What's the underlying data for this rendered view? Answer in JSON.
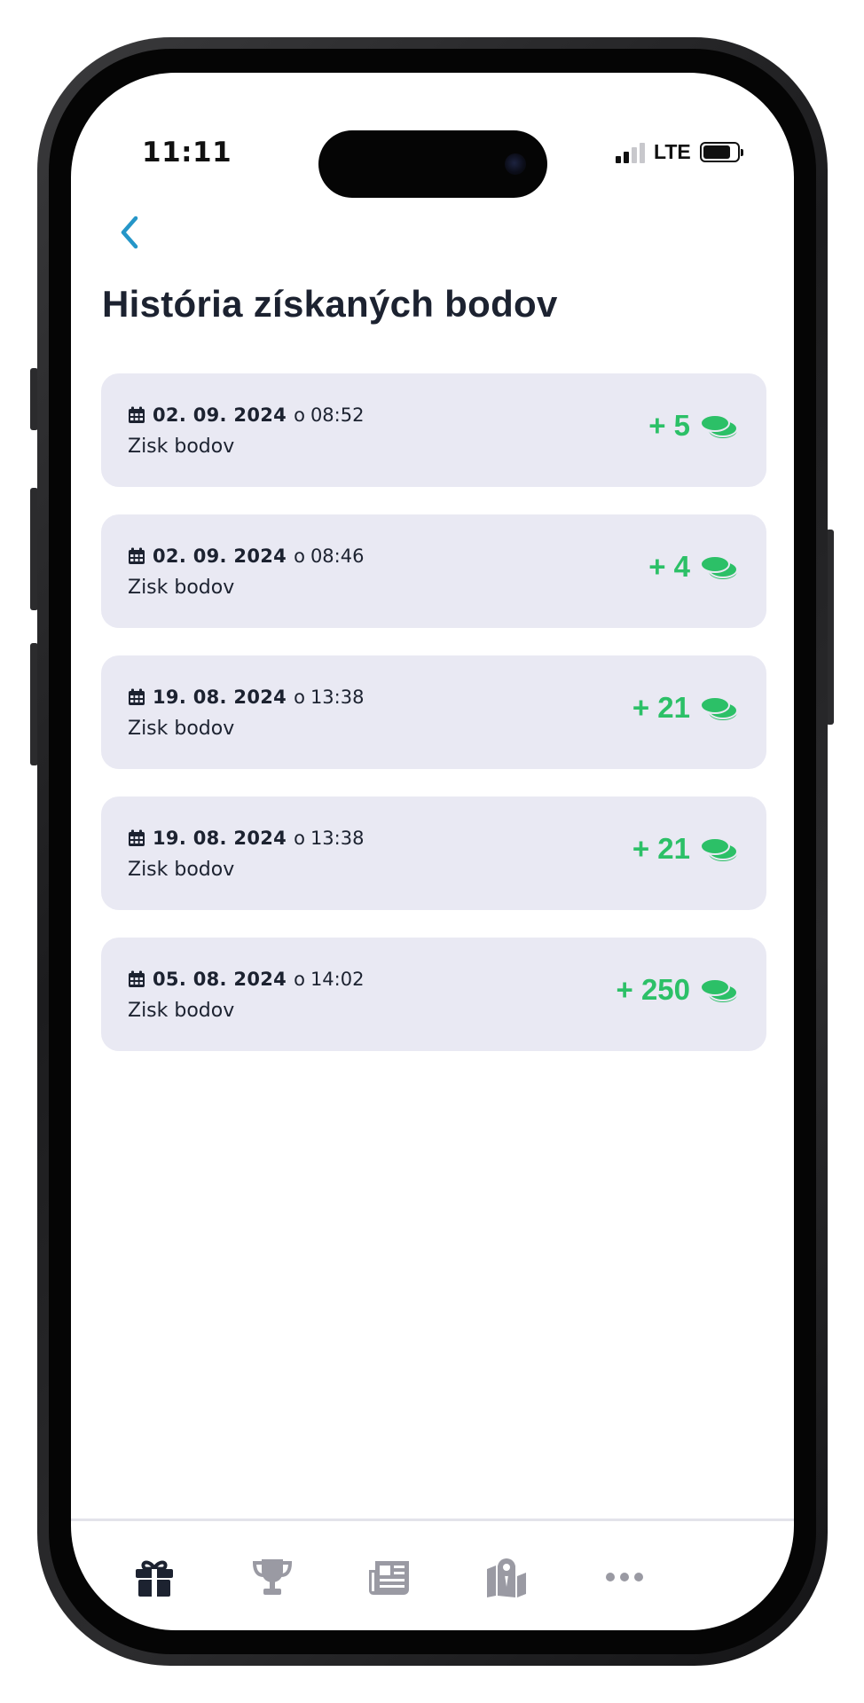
{
  "status_bar": {
    "time": "11:11",
    "network": "LTE"
  },
  "page": {
    "title": "História získaných bodov"
  },
  "history": [
    {
      "date": "02. 09. 2024",
      "time_prefix": "o",
      "time": "08:52",
      "label": "Zisk bodov",
      "points": "+ 5"
    },
    {
      "date": "02. 09. 2024",
      "time_prefix": "o",
      "time": "08:46",
      "label": "Zisk bodov",
      "points": "+ 4"
    },
    {
      "date": "19. 08. 2024",
      "time_prefix": "o",
      "time": "13:38",
      "label": "Zisk bodov",
      "points": "+ 21"
    },
    {
      "date": "19. 08. 2024",
      "time_prefix": "o",
      "time": "13:38",
      "label": "Zisk bodov",
      "points": "+ 21"
    },
    {
      "date": "05. 08. 2024",
      "time_prefix": "o",
      "time": "14:02",
      "label": "Zisk bodov",
      "points": "+ 250"
    }
  ],
  "tab_bar": {
    "items": [
      {
        "icon": "gift-icon",
        "active": true
      },
      {
        "icon": "trophy-icon",
        "active": false
      },
      {
        "icon": "newspaper-icon",
        "active": false
      },
      {
        "icon": "map-icon",
        "active": false
      },
      {
        "icon": "more-icon",
        "active": false
      }
    ]
  },
  "colors": {
    "accent_back": "#2596c8",
    "points_green": "#2cc067",
    "card_bg": "#e9e9f3",
    "text_dark": "#1c2230",
    "tab_active": "#1c2230",
    "tab_inactive": "#9a9aa3"
  }
}
